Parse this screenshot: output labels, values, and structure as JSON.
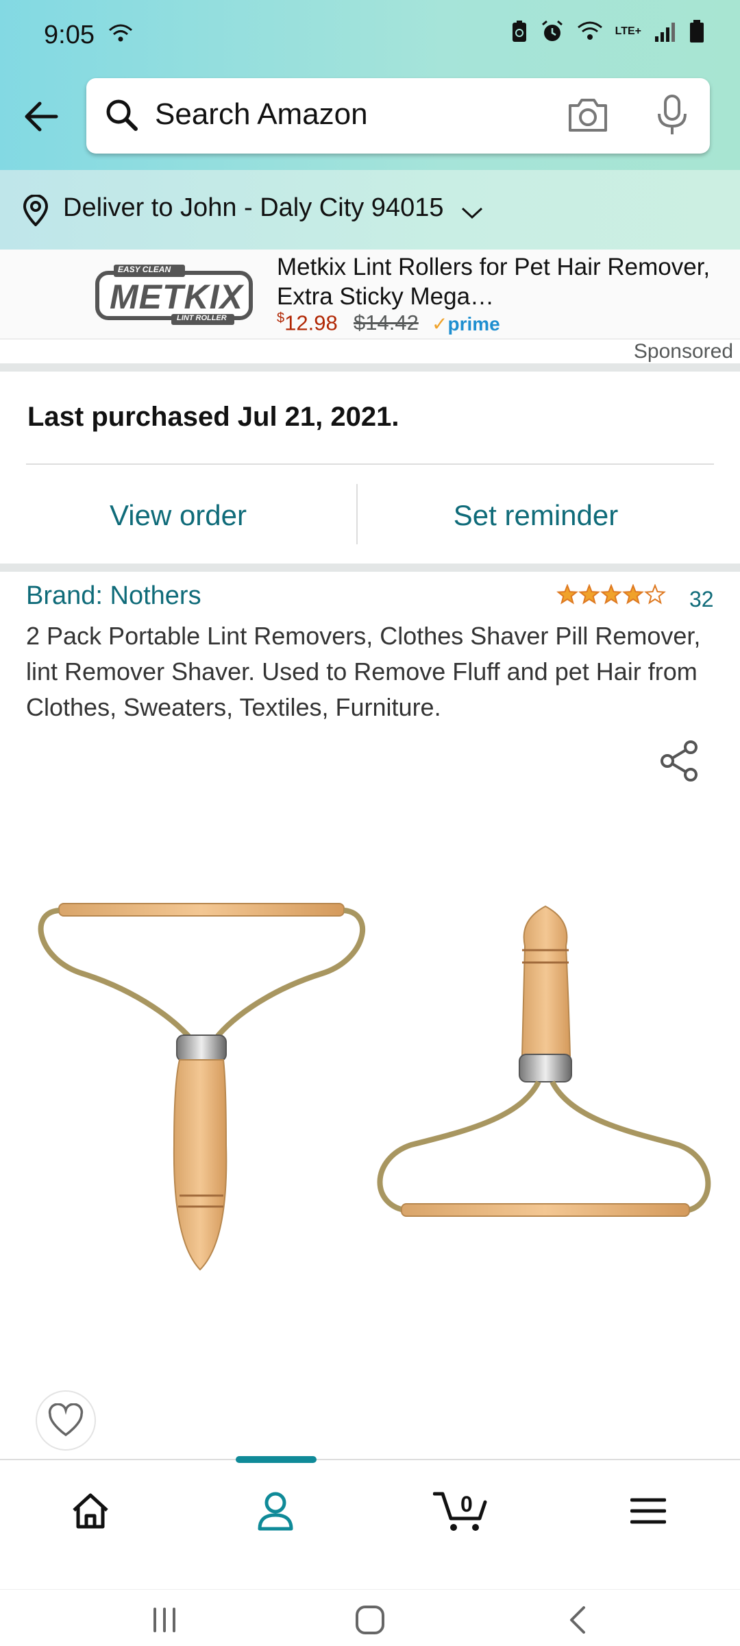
{
  "status_bar": {
    "time": "9:05",
    "network": "LTE+"
  },
  "search": {
    "placeholder": "Search Amazon"
  },
  "deliver": {
    "text": "Deliver to John - Daly City 94015"
  },
  "ad": {
    "brand_logo_text": "METKIX",
    "brand_logo_top": "EASY CLEAN",
    "brand_logo_bottom": "LINT ROLLER",
    "title": "Metkix Lint Rollers for Pet Hair Remover, Extra Sticky Mega…",
    "price_currency": "$",
    "price": "12.98",
    "old_price": "$14.42",
    "prime": "prime",
    "sponsored_label": "Sponsored"
  },
  "purchase": {
    "last_purchased": "Last purchased Jul 21, 2021.",
    "view_order": "View order",
    "set_reminder": "Set reminder"
  },
  "product": {
    "brand": "Brand: Nothers",
    "rating": 4,
    "rating_max": 5,
    "rating_count": "32",
    "title": "2 Pack Portable Lint Removers, Clothes Shaver Pill Remover, lint Remover Shaver. Used to Remove Fluff and pet Hair from Clothes, Sweaters, Textiles, Furniture."
  },
  "bottom_nav": {
    "items": [
      "home",
      "account",
      "cart",
      "menu"
    ],
    "active": "account",
    "cart_count": "0"
  },
  "colors": {
    "link_teal": "#0f6b79",
    "price_red": "#b12704",
    "star_orange": "#f0a22a",
    "active_tab": "#0f8a98"
  }
}
